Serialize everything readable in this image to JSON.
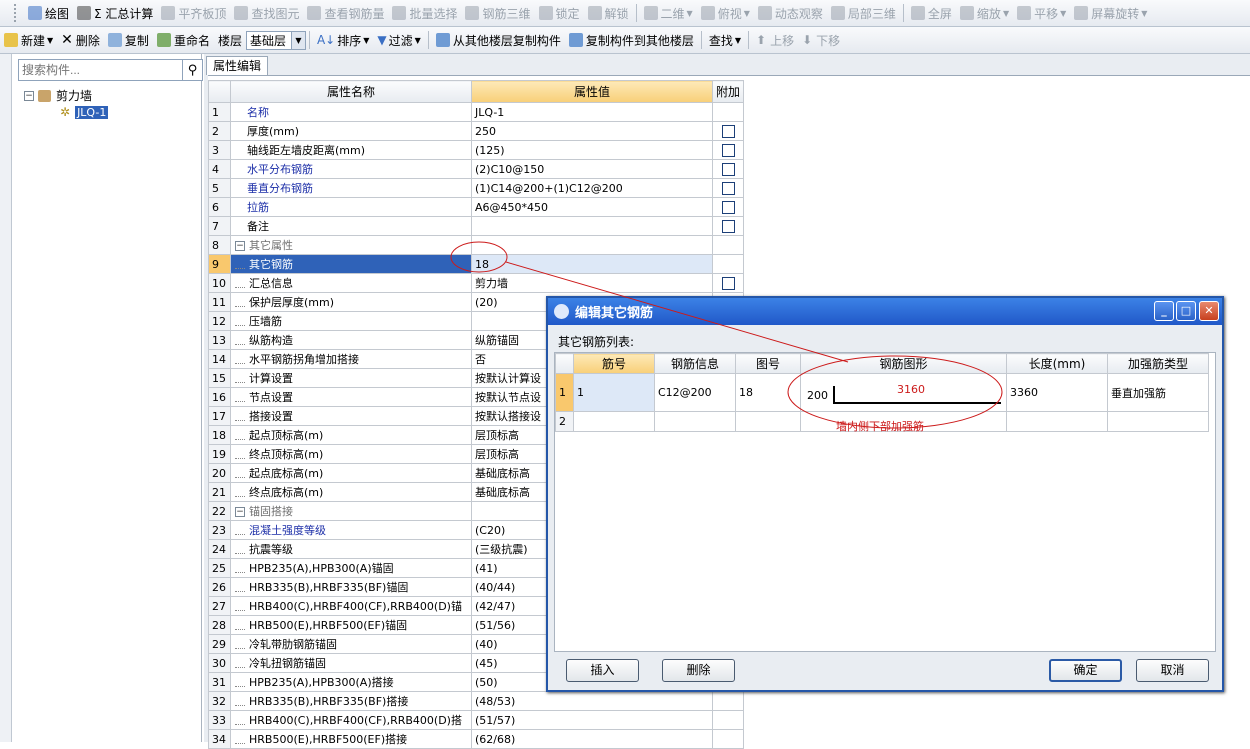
{
  "toolbar1": {
    "items": [
      {
        "label": "绘图",
        "icon": "draw-icon",
        "color": "#3a6fc4",
        "enabled": true
      },
      {
        "label": "Σ 汇总计算",
        "icon": "sum-icon",
        "color": "#444444",
        "enabled": true
      },
      {
        "label": "平齐板顶",
        "icon": "align-top-icon",
        "color": "#9aa3ad",
        "enabled": false
      },
      {
        "label": "查找图元",
        "icon": "find-element-icon",
        "color": "#9aa3ad",
        "enabled": false
      },
      {
        "label": "查看钢筋量",
        "icon": "view-rebar-icon",
        "color": "#9aa3ad",
        "enabled": false
      },
      {
        "label": "批量选择",
        "icon": "batch-select-icon",
        "color": "#9aa3ad",
        "enabled": false
      },
      {
        "label": "钢筋三维",
        "icon": "rebar-3d-icon",
        "color": "#9aa3ad",
        "enabled": false
      },
      {
        "label": "锁定",
        "icon": "lock-icon",
        "color": "#9aa3ad",
        "enabled": false
      },
      {
        "label": "解锁",
        "icon": "unlock-icon",
        "color": "#9aa3ad",
        "enabled": false
      },
      {
        "label": "二维",
        "icon": "2d-icon",
        "color": "#9aa3ad",
        "enabled": false,
        "dropdown": true
      },
      {
        "label": "俯视",
        "icon": "top-view-icon",
        "color": "#9aa3ad",
        "enabled": false,
        "dropdown": true
      },
      {
        "label": "动态观察",
        "icon": "orbit-icon",
        "color": "#9aa3ad",
        "enabled": false
      },
      {
        "label": "局部三维",
        "icon": "local-3d-icon",
        "color": "#9aa3ad",
        "enabled": false
      },
      {
        "label": "全屏",
        "icon": "fullscreen-icon",
        "color": "#9aa3ad",
        "enabled": false
      },
      {
        "label": "缩放",
        "icon": "zoom-icon",
        "color": "#9aa3ad",
        "enabled": false,
        "dropdown": true
      },
      {
        "label": "平移",
        "icon": "pan-icon",
        "color": "#9aa3ad",
        "enabled": false,
        "dropdown": true
      },
      {
        "label": "屏幕旋转",
        "icon": "rotate-screen-icon",
        "color": "#9aa3ad",
        "enabled": false,
        "dropdown": true
      }
    ]
  },
  "toolbar2": {
    "new_label": "新建",
    "delete_label": "删除",
    "copy_label": "复制",
    "rename_label": "重命名",
    "floor_label": "楼层",
    "floor_value": "基础层",
    "sort_label": "排序",
    "filter_label": "过滤",
    "copy_from_label": "从其他楼层复制构件",
    "copy_to_label": "复制构件到其他楼层",
    "find_label": "查找",
    "move_up_label": "上移",
    "move_down_label": "下移"
  },
  "tree": {
    "search_placeholder": "搜索构件...",
    "root_label": "剪力墙",
    "child_label": "JLQ-1"
  },
  "property_panel": {
    "tab_label": "属性编辑",
    "headers": {
      "name": "属性名称",
      "value": "属性值",
      "extra": "附加"
    },
    "rows": [
      {
        "n": "1",
        "name": "名称",
        "value": "JLQ-1",
        "style": "blue",
        "level": 0,
        "cb": false
      },
      {
        "n": "2",
        "name": "厚度(mm)",
        "value": "250",
        "style": "",
        "level": 0,
        "cb": true
      },
      {
        "n": "3",
        "name": "轴线距左墙皮距离(mm)",
        "value": "(125)",
        "style": "",
        "level": 0,
        "cb": true
      },
      {
        "n": "4",
        "name": "水平分布钢筋",
        "value": "(2)C10@150",
        "style": "blue",
        "level": 0,
        "cb": true
      },
      {
        "n": "5",
        "name": "垂直分布钢筋",
        "value": "(1)C14@200+(1)C12@200",
        "style": "blue",
        "level": 0,
        "cb": true
      },
      {
        "n": "6",
        "name": "拉筋",
        "value": "A6@450*450",
        "style": "blue",
        "level": 0,
        "cb": true
      },
      {
        "n": "7",
        "name": "备注",
        "value": "",
        "style": "",
        "level": 0,
        "cb": true
      },
      {
        "n": "8",
        "name": "其它属性",
        "value": "",
        "style": "gray",
        "level": -1,
        "cb": false
      },
      {
        "n": "9",
        "name": "其它钢筋",
        "value": "18",
        "style": "",
        "level": 1,
        "cb": false,
        "selected": true
      },
      {
        "n": "10",
        "name": "汇总信息",
        "value": "剪力墙",
        "style": "",
        "level": 1,
        "cb": true
      },
      {
        "n": "11",
        "name": "保护层厚度(mm)",
        "value": "(20)",
        "style": "",
        "level": 1,
        "cb": false
      },
      {
        "n": "12",
        "name": "压墙筋",
        "value": "",
        "style": "",
        "level": 1,
        "cb": false
      },
      {
        "n": "13",
        "name": "纵筋构造",
        "value": "纵筋锚固",
        "style": "",
        "level": 1,
        "cb": false
      },
      {
        "n": "14",
        "name": "水平钢筋拐角增加搭接",
        "value": "否",
        "style": "",
        "level": 1,
        "cb": false
      },
      {
        "n": "15",
        "name": "计算设置",
        "value": "按默认计算设",
        "style": "",
        "level": 1,
        "cb": false
      },
      {
        "n": "16",
        "name": "节点设置",
        "value": "按默认节点设",
        "style": "",
        "level": 1,
        "cb": false
      },
      {
        "n": "17",
        "name": "搭接设置",
        "value": "按默认搭接设",
        "style": "",
        "level": 1,
        "cb": false
      },
      {
        "n": "18",
        "name": "起点顶标高(m)",
        "value": "层顶标高",
        "style": "",
        "level": 1,
        "cb": false
      },
      {
        "n": "19",
        "name": "终点顶标高(m)",
        "value": "层顶标高",
        "style": "",
        "level": 1,
        "cb": false
      },
      {
        "n": "20",
        "name": "起点底标高(m)",
        "value": "基础底标高",
        "style": "",
        "level": 1,
        "cb": false
      },
      {
        "n": "21",
        "name": "终点底标高(m)",
        "value": "基础底标高",
        "style": "",
        "level": 1,
        "cb": false
      },
      {
        "n": "22",
        "name": "锚固搭接",
        "value": "",
        "style": "gray",
        "level": -1,
        "cb": false
      },
      {
        "n": "23",
        "name": "混凝土强度等级",
        "value": "(C20)",
        "style": "blue",
        "level": 1,
        "cb": false
      },
      {
        "n": "24",
        "name": "抗震等级",
        "value": "(三级抗震)",
        "style": "",
        "level": 1,
        "cb": false
      },
      {
        "n": "25",
        "name": "HPB235(A),HPB300(A)锚固",
        "value": "(41)",
        "style": "",
        "level": 1,
        "cb": false
      },
      {
        "n": "26",
        "name": "HRB335(B),HRBF335(BF)锚固",
        "value": "(40/44)",
        "style": "",
        "level": 1,
        "cb": false
      },
      {
        "n": "27",
        "name": "HRB400(C),HRBF400(CF),RRB400(D)锚",
        "value": "(42/47)",
        "style": "",
        "level": 1,
        "cb": false
      },
      {
        "n": "28",
        "name": "HRB500(E),HRBF500(EF)锚固",
        "value": "(51/56)",
        "style": "",
        "level": 1,
        "cb": false
      },
      {
        "n": "29",
        "name": "冷轧带肋钢筋锚固",
        "value": "(40)",
        "style": "",
        "level": 1,
        "cb": false
      },
      {
        "n": "30",
        "name": "冷轧扭钢筋锚固",
        "value": "(45)",
        "style": "",
        "level": 1,
        "cb": false
      },
      {
        "n": "31",
        "name": "HPB235(A),HPB300(A)搭接",
        "value": "(50)",
        "style": "",
        "level": 1,
        "cb": false
      },
      {
        "n": "32",
        "name": "HRB335(B),HRBF335(BF)搭接",
        "value": "(48/53)",
        "style": "",
        "level": 1,
        "cb": false
      },
      {
        "n": "33",
        "name": "HRB400(C),HRBF400(CF),RRB400(D)搭",
        "value": "(51/57)",
        "style": "",
        "level": 1,
        "cb": false
      },
      {
        "n": "34",
        "name": "HRB500(E),HRBF500(EF)搭接",
        "value": "(62/68)",
        "style": "",
        "level": 1,
        "cb": false
      }
    ]
  },
  "dialog": {
    "title": "编辑其它钢筋",
    "list_label": "其它钢筋列表:",
    "headers": [
      "筋号",
      "钢筋信息",
      "图号",
      "钢筋图形",
      "长度(mm)",
      "加强筋类型"
    ],
    "rows": [
      {
        "n": "1",
        "bar_no": "1",
        "info": "C12@200",
        "shape_no": "18",
        "shape_left": "200",
        "shape_len": "3160",
        "length": "3360",
        "type": "垂直加强筋"
      },
      {
        "n": "2",
        "bar_no": "",
        "info": "",
        "shape_no": "",
        "shape_left": "",
        "shape_len": "",
        "length": "",
        "type": ""
      }
    ],
    "insert_label": "插入",
    "delete_label": "删除",
    "ok_label": "确定",
    "cancel_label": "取消",
    "annotation": "墙内侧下部加强筋"
  },
  "colors": {
    "annotation": "#cc1a1a",
    "selection": "#2f62b8",
    "header_highlight": "#f8cf78",
    "title_bar": "#2058c8"
  }
}
